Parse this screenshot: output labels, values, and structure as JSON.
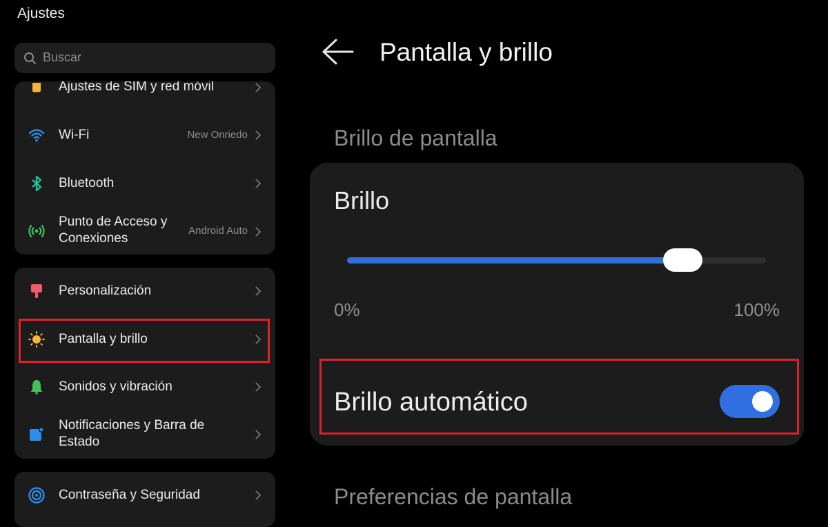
{
  "app": {
    "title": "Ajustes"
  },
  "search": {
    "placeholder": "Buscar"
  },
  "sidebar": {
    "group1": [
      {
        "label": "Ajustes de SIM y red móvil",
        "value": "",
        "icon": "sim-card-icon"
      },
      {
        "label": "Wi-Fi",
        "value": "New Onriedo",
        "icon": "wifi-icon"
      },
      {
        "label": "Bluetooth",
        "value": "",
        "icon": "bluetooth-icon"
      },
      {
        "label": "Punto de Acceso y Conexiones",
        "value": "Android Auto",
        "icon": "hotspot-icon"
      }
    ],
    "group2": [
      {
        "label": "Personalización",
        "icon": "brush-icon"
      },
      {
        "label": "Pantalla y brillo",
        "icon": "sun-icon",
        "selected": true
      },
      {
        "label": "Sonidos y vibración",
        "icon": "bell-icon"
      },
      {
        "label": "Notificaciones y Barra de Estado",
        "icon": "notification-icon"
      }
    ],
    "group3": [
      {
        "label": "Contraseña y Seguridad",
        "icon": "security-icon"
      }
    ]
  },
  "header": {
    "title": "Pantalla y brillo"
  },
  "brightness": {
    "section_title": "Brillo de pantalla",
    "label": "Brillo",
    "level": 0.8,
    "min_label": "0%",
    "max_label": "100%",
    "auto_label": "Brillo automático",
    "auto_enabled": true
  },
  "display_prefs": {
    "section_title": "Preferencias de pantalla"
  },
  "colors": {
    "accent": "#2f6fe0",
    "highlight": "#e0202c",
    "card": "#1c1c1c",
    "background": "#000000"
  }
}
